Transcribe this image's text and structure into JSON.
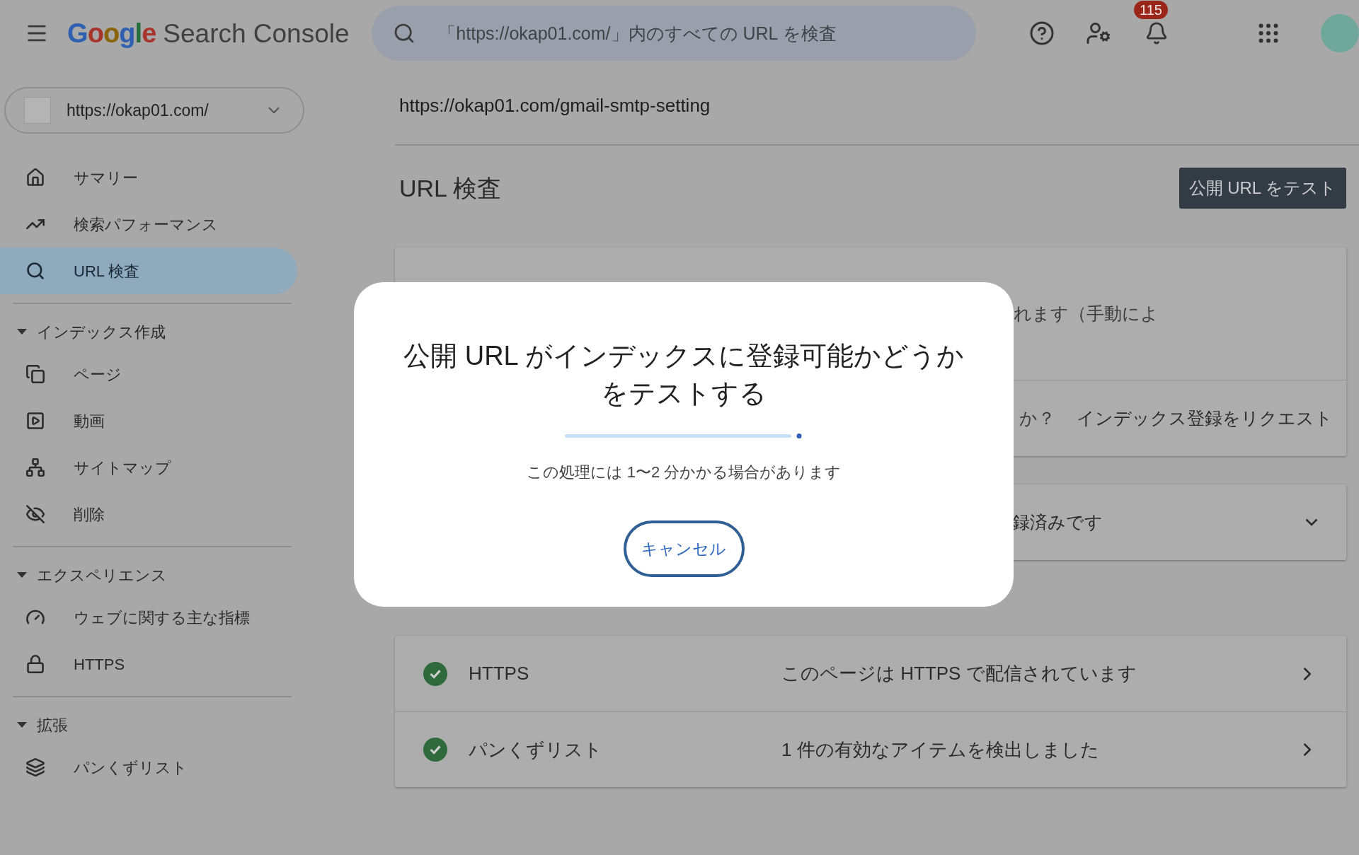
{
  "topbar": {
    "logo_brand": "Google",
    "logo_product": "Search Console",
    "search": {
      "placeholder": "「https://okap01.com/」内のすべての URL を検査"
    },
    "notification_count": "115"
  },
  "property": {
    "url": "https://okap01.com/"
  },
  "sidebar": {
    "items": [
      {
        "label": "サマリー",
        "selected": false
      },
      {
        "label": "検索パフォーマンス",
        "selected": false
      },
      {
        "label": "URL 検査",
        "selected": true
      }
    ],
    "sections": [
      {
        "title": "インデックス作成",
        "expanded": true,
        "items": [
          {
            "label": "ページ",
            "selected": false
          },
          {
            "label": "動画",
            "selected": false
          },
          {
            "label": "サイトマップ",
            "selected": false
          },
          {
            "label": "削除",
            "selected": false
          }
        ]
      },
      {
        "title": "エクスペリエンス",
        "expanded": true,
        "items": [
          {
            "label": "ウェブに関する主な指標",
            "selected": false
          },
          {
            "label": "HTTPS",
            "selected": false
          }
        ]
      },
      {
        "title": "拡張",
        "expanded": true,
        "items": [
          {
            "label": "パンくずリスト",
            "selected": false
          }
        ]
      }
    ]
  },
  "page": {
    "url": "https://okap01.com/gmail-smtp-setting",
    "title": "URL 検査",
    "test_button": "公開 URL をテスト"
  },
  "index_card": {
    "note": "れます（手動によ",
    "question": "か？",
    "request_link": "インデックス登録をリクエスト"
  },
  "coverage_card": {
    "status": "録済みです",
    "expanded": false
  },
  "enhancements": [
    {
      "name": "HTTPS",
      "status": "このページは HTTPS で配信されています",
      "valid": true
    },
    {
      "name": "パンくずリスト",
      "status": "1 件の有効なアイテムを検出しました",
      "valid": true
    }
  ],
  "dialog": {
    "title": "公開 URL がインデックスに登録可能かどうかをテストする",
    "message": "この処理には 1〜2 分かかる場合があります",
    "cancel": "キャンセル"
  }
}
